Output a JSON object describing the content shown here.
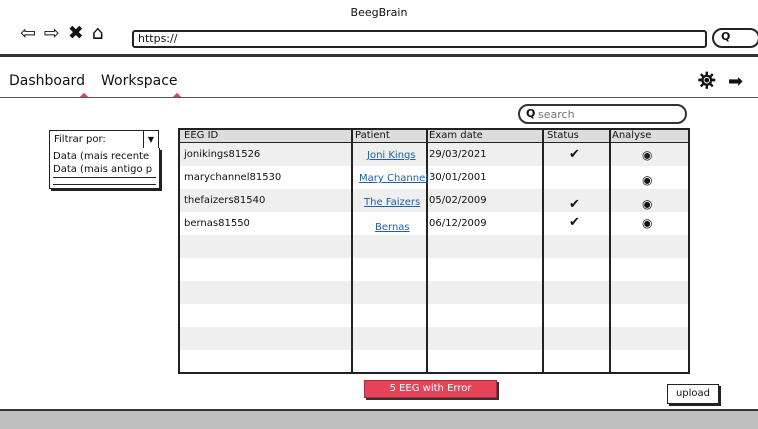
{
  "window": {
    "title": "BeegBrain"
  },
  "browser": {
    "url": "https://",
    "icons": [
      "back-arrow-icon",
      "forward-arrow-icon",
      "close-x-icon",
      "home-icon",
      "search-icon"
    ]
  },
  "menu": {
    "dashboard": "Dashboard",
    "workspace": "Workspace"
  },
  "search": {
    "placeholder": "search"
  },
  "filter": {
    "label": "Filtrar por:",
    "options": [
      "Data (mais recente",
      "Data (mais antigo p"
    ]
  },
  "table": {
    "headers": [
      "EEG ID",
      "Patient",
      "Exam date",
      "Status",
      "Analyse"
    ],
    "rows": [
      {
        "eeg_id": "jonikings81526",
        "patient": "Joni Kings",
        "exam_date": "29/03/2021",
        "status": "check",
        "analyse": "eye"
      },
      {
        "eeg_id": "marychannel81530",
        "patient": "Mary Channel",
        "exam_date": "30/01/2001",
        "status": "",
        "analyse": "eye"
      },
      {
        "eeg_id": "thefaizers81540",
        "patient": "The Faizers",
        "exam_date": "05/02/2009",
        "status": "check",
        "analyse": "eye"
      },
      {
        "eeg_id": "bernas81550",
        "patient": "Bernas",
        "exam_date": "06/12/2009",
        "status": "check",
        "analyse": "eye"
      }
    ]
  },
  "actions": {
    "error_label": "5 EEG with Error",
    "upload_label": "upload"
  },
  "colors": {
    "accent": "#e64458",
    "link": "#1f5fa8",
    "row_alt": "#efefef"
  }
}
